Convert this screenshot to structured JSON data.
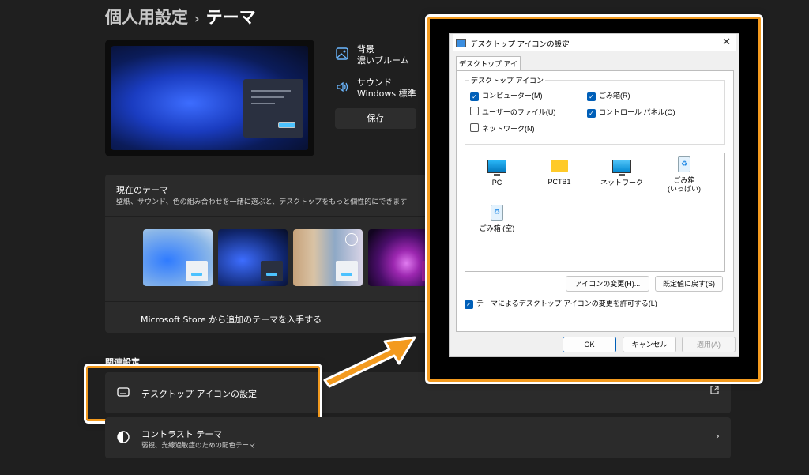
{
  "settings": {
    "breadcrumb": {
      "parent": "個人用設定",
      "current": "テーマ"
    },
    "properties": {
      "background": {
        "label": "背景",
        "value": "濃いブルーム"
      },
      "sound": {
        "label": "サウンド",
        "value": "Windows 標準"
      },
      "save_label": "保存"
    },
    "current_theme": {
      "title": "現在のテーマ",
      "description": "壁紙、サウンド、色の組み合わせを一緒に選ぶと、デスクトップをもっと個性的にできます",
      "store_link": "Microsoft Store から追加のテーマを入手する"
    },
    "related": {
      "heading": "関連設定",
      "desktop_icons": "デスクトップ アイコンの設定",
      "contrast": {
        "label": "コントラスト テーマ",
        "sub": "弱視、光線過敏症のための配色テーマ"
      }
    }
  },
  "dialog": {
    "title": "デスクトップ アイコンの設定",
    "tab": "デスクトップ アイコン",
    "group_title": "デスクトップ アイコン",
    "checkboxes": [
      {
        "label": "コンピューター(M)",
        "checked": true
      },
      {
        "label": "ごみ箱(R)",
        "checked": true
      },
      {
        "label": "ユーザーのファイル(U)",
        "checked": false
      },
      {
        "label": "コントロール パネル(O)",
        "checked": true
      },
      {
        "label": "ネットワーク(N)",
        "checked": false
      }
    ],
    "icons": [
      {
        "name": "PC",
        "icon": "pc-icon"
      },
      {
        "name": "PCTB1",
        "icon": "folder-icon"
      },
      {
        "name": "ネットワーク",
        "icon": "network-icon"
      },
      {
        "name": "ごみ箱",
        "name2": "(いっぱい)",
        "icon": "recycle-bin-full-icon"
      },
      {
        "name": "ごみ箱 (空)",
        "icon": "recycle-bin-empty-icon"
      }
    ],
    "change_icon": "アイコンの変更(H)...",
    "restore_default": "既定値に戻す(S)",
    "allow_themes": "テーマによるデスクトップ アイコンの変更を許可する(L)",
    "allow_themes_checked": true,
    "ok": "OK",
    "cancel": "キャンセル",
    "apply": "適用(A)"
  },
  "colors": {
    "accent": "#4cc2ff",
    "highlight": "#f39a1e",
    "dialog_check": "#005fb8"
  }
}
